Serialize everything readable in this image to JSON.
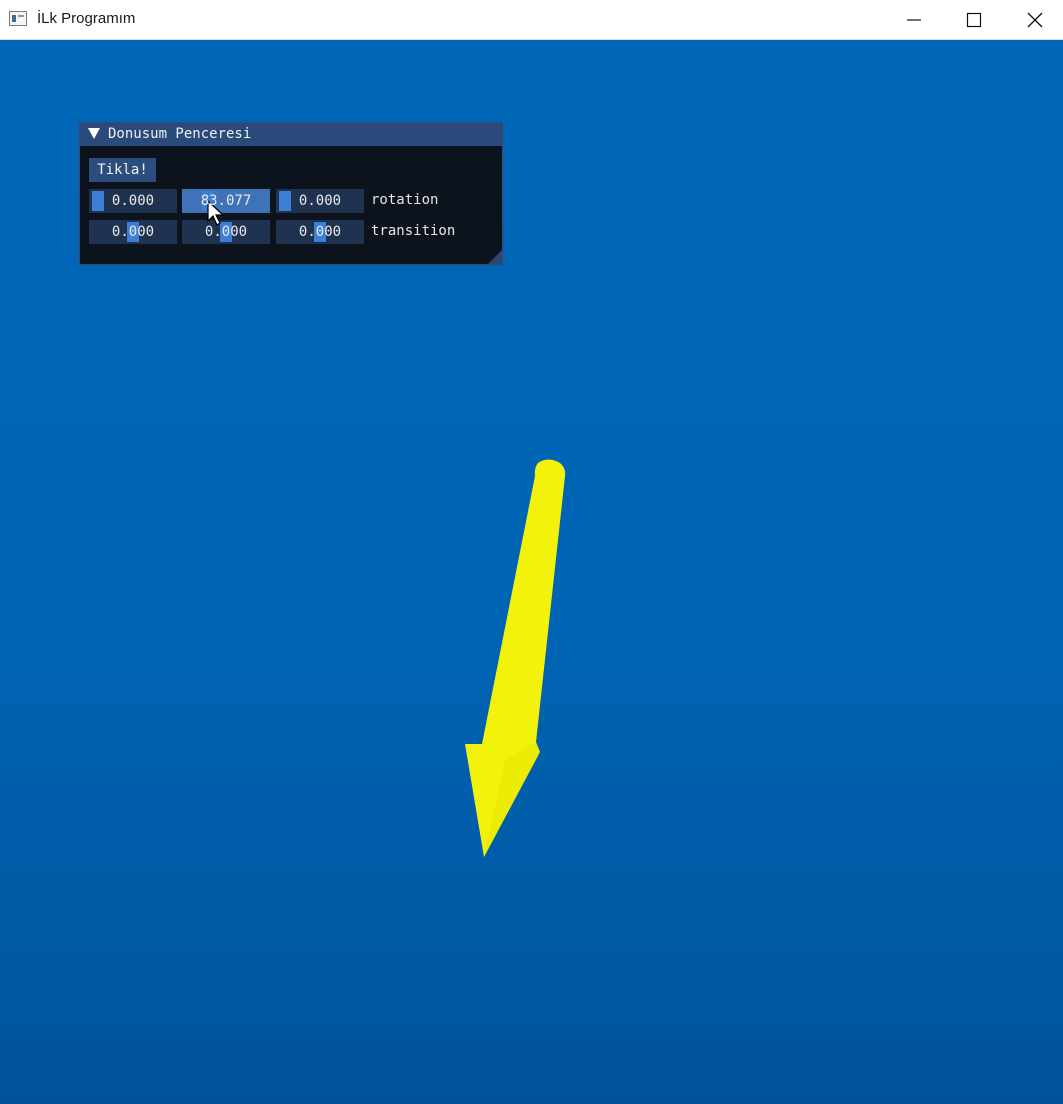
{
  "window": {
    "title": "İLk Programım",
    "icon": "app-window-icon",
    "controls": [
      "minimize-icon",
      "maximize-icon",
      "close-icon"
    ]
  },
  "imgui_panel": {
    "title": "Donusum Penceresi",
    "button_label": "Tikla!",
    "rotation": {
      "label": "rotation",
      "values": [
        "0.000",
        "83.077",
        "0.000"
      ]
    },
    "transition": {
      "label": "transition",
      "values": [
        "0.000",
        "0.000",
        "0.000"
      ]
    }
  },
  "scene": {
    "background_color": "#0066b8",
    "arrow_color": "#f2f20a"
  },
  "colors": {
    "imgui_header": "#294a7a",
    "imgui_bg": "#0d1016",
    "drag_active": "#3f73b8",
    "drag_frame": "#1f324f"
  }
}
